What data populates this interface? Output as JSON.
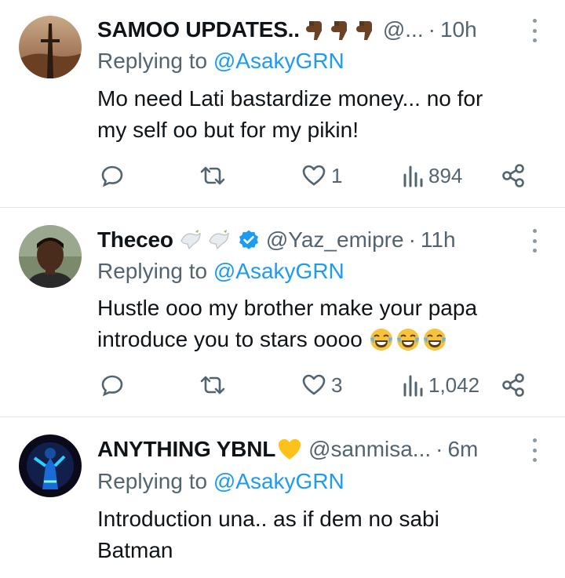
{
  "tweets": [
    {
      "name": "SAMOO UPDATES..",
      "handle": "@...",
      "time": "10h",
      "replying_prefix": "Replying to ",
      "replying_mention": "@AsakyGRN",
      "text_line1": "Mo need Lati bastardize money... no for",
      "text_line2": "my self oo but for my pikin!",
      "replies": "",
      "likes": "1",
      "views": "894",
      "emojis": [
        "pointing-down-hand-icon",
        "pointing-down-hand-icon",
        "pointing-down-hand-icon"
      ]
    },
    {
      "name": "Theceo",
      "handle": "@Yaz_emipre",
      "time": "11h",
      "replying_prefix": "Replying to ",
      "replying_mention": "@AsakyGRN",
      "text_line1": "Hustle ooo my brother make your papa",
      "text_line2": "introduce you to stars oooo",
      "likes": "3",
      "views": "1,042",
      "emojis": [
        "dove-icon",
        "dove-icon"
      ],
      "text_emojis": [
        "laughing-face-icon",
        "laughing-face-icon",
        "laughing-face-icon"
      ],
      "verified": true
    },
    {
      "name": "ANYTHING YBNL",
      "handle": "@sanmisa...",
      "time": "6m",
      "replying_prefix": "Replying to ",
      "replying_mention": "@AsakyGRN",
      "text_line1": "Introduction una.. as if dem no sabi",
      "text_line2": "Batman",
      "emojis": [
        "yellow-heart-icon"
      ]
    }
  ],
  "dot_separator": "·",
  "colors": {
    "link": "#1d9bf0",
    "muted": "#536471",
    "verified": "#1d9bf0"
  }
}
